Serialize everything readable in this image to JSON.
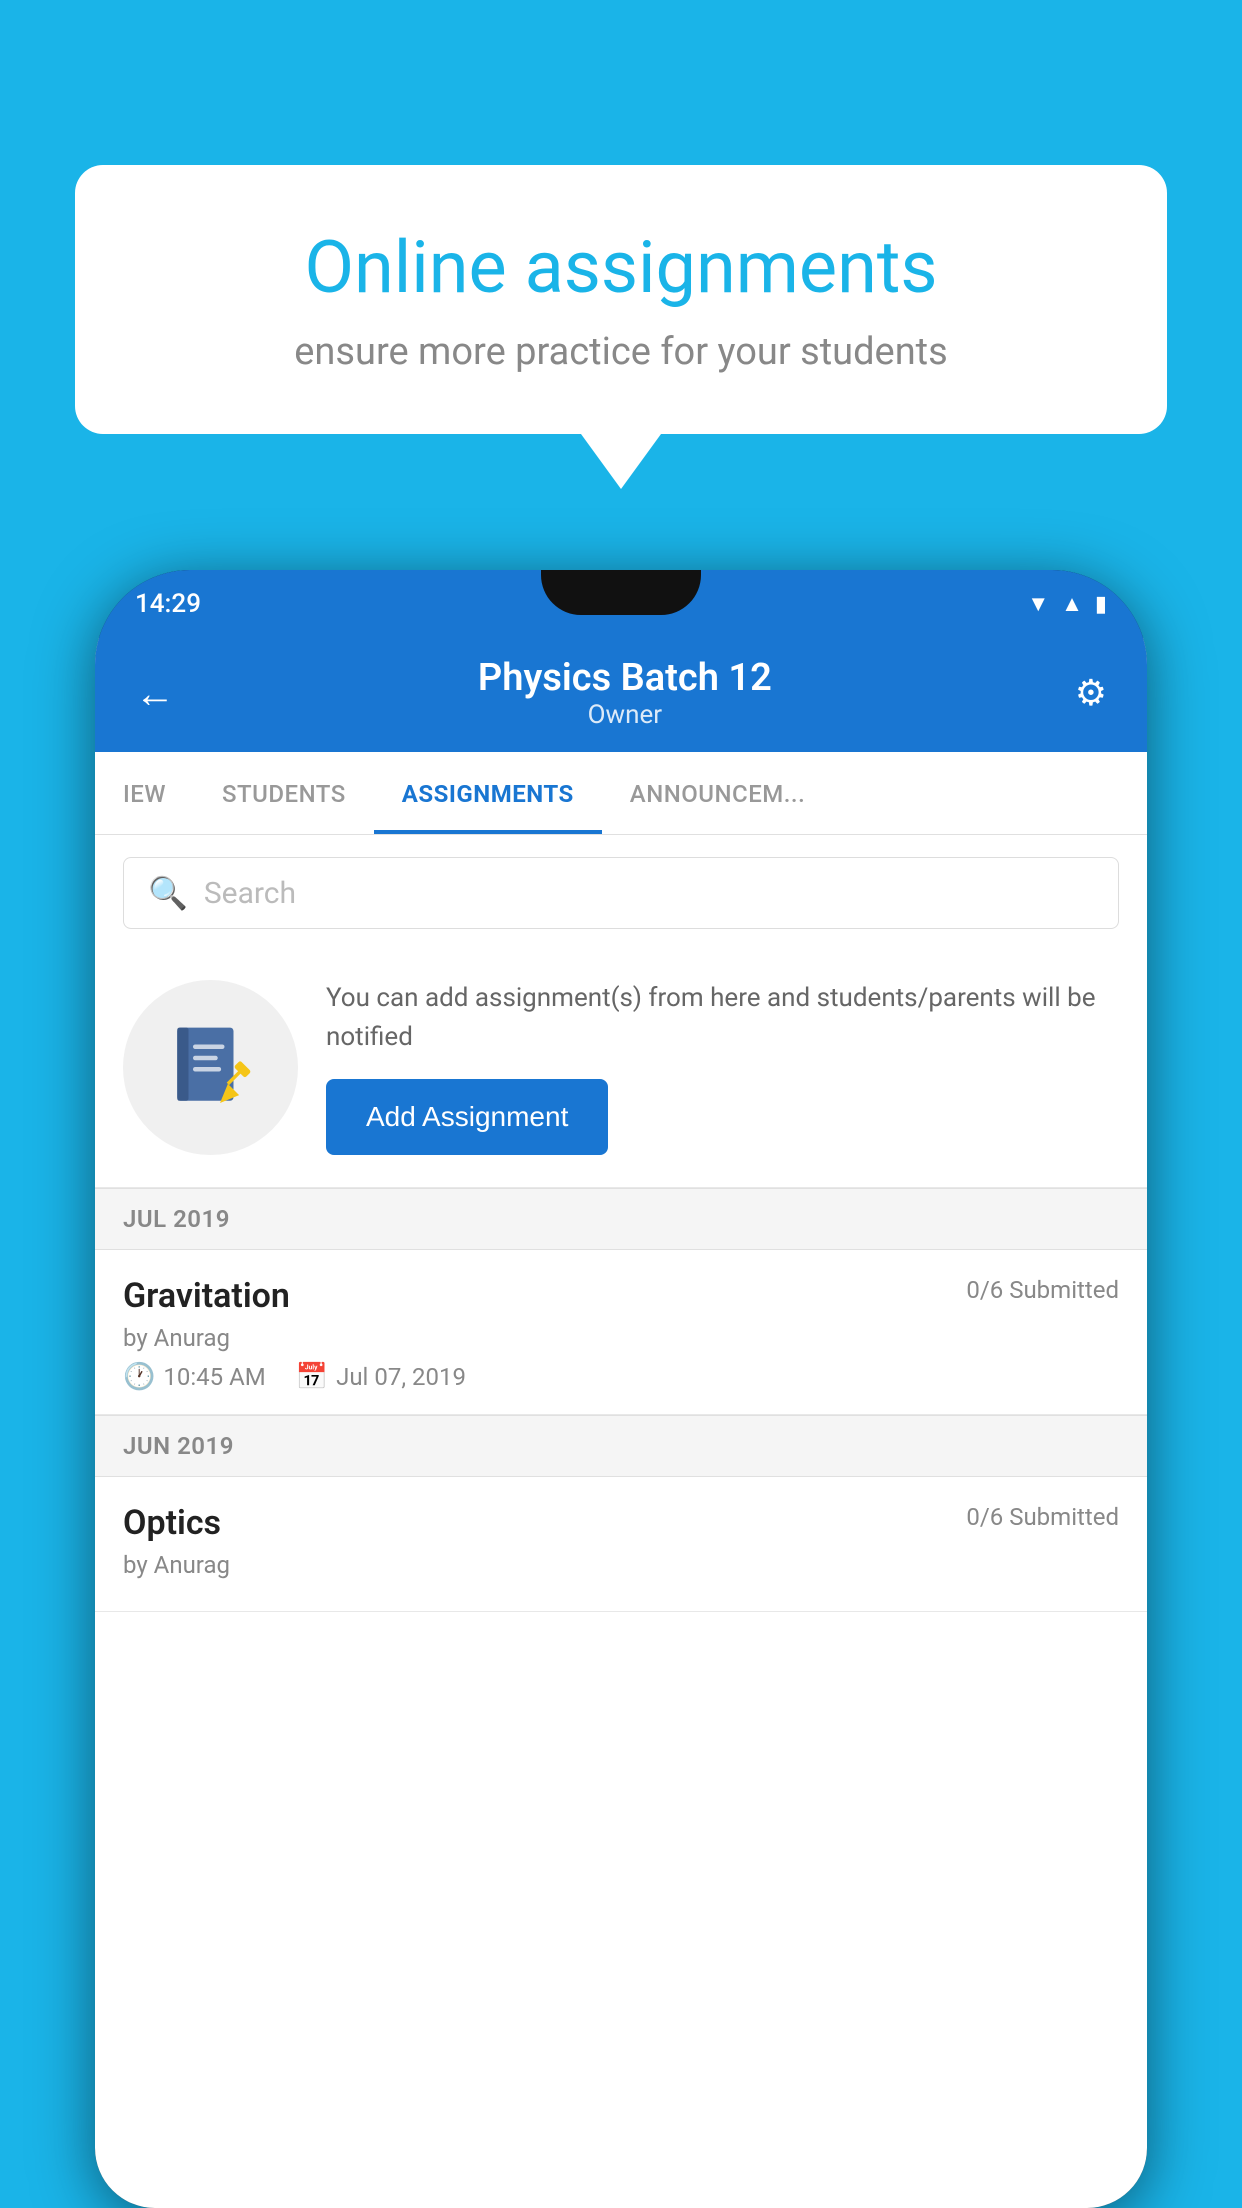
{
  "background_color": "#1ab4e8",
  "speech_bubble": {
    "title": "Online assignments",
    "subtitle": "ensure more practice for your students"
  },
  "phone": {
    "status_bar": {
      "time": "14:29",
      "icons": [
        "wifi",
        "signal",
        "battery"
      ]
    },
    "header": {
      "title": "Physics Batch 12",
      "subtitle": "Owner",
      "back_label": "←",
      "settings_label": "⚙"
    },
    "tabs": [
      {
        "label": "IEW",
        "active": false
      },
      {
        "label": "STUDENTS",
        "active": false
      },
      {
        "label": "ASSIGNMENTS",
        "active": true
      },
      {
        "label": "ANNOUNCEM...",
        "active": false
      }
    ],
    "search": {
      "placeholder": "Search"
    },
    "promo": {
      "description": "You can add assignment(s) from here and students/parents will be notified",
      "button_label": "Add Assignment"
    },
    "sections": [
      {
        "month_label": "JUL 2019",
        "assignments": [
          {
            "title": "Gravitation",
            "submitted": "0/6 Submitted",
            "by": "by Anurag",
            "time": "10:45 AM",
            "date": "Jul 07, 2019"
          }
        ]
      },
      {
        "month_label": "JUN 2019",
        "assignments": [
          {
            "title": "Optics",
            "submitted": "0/6 Submitted",
            "by": "by Anurag",
            "time": "",
            "date": ""
          }
        ]
      }
    ]
  }
}
